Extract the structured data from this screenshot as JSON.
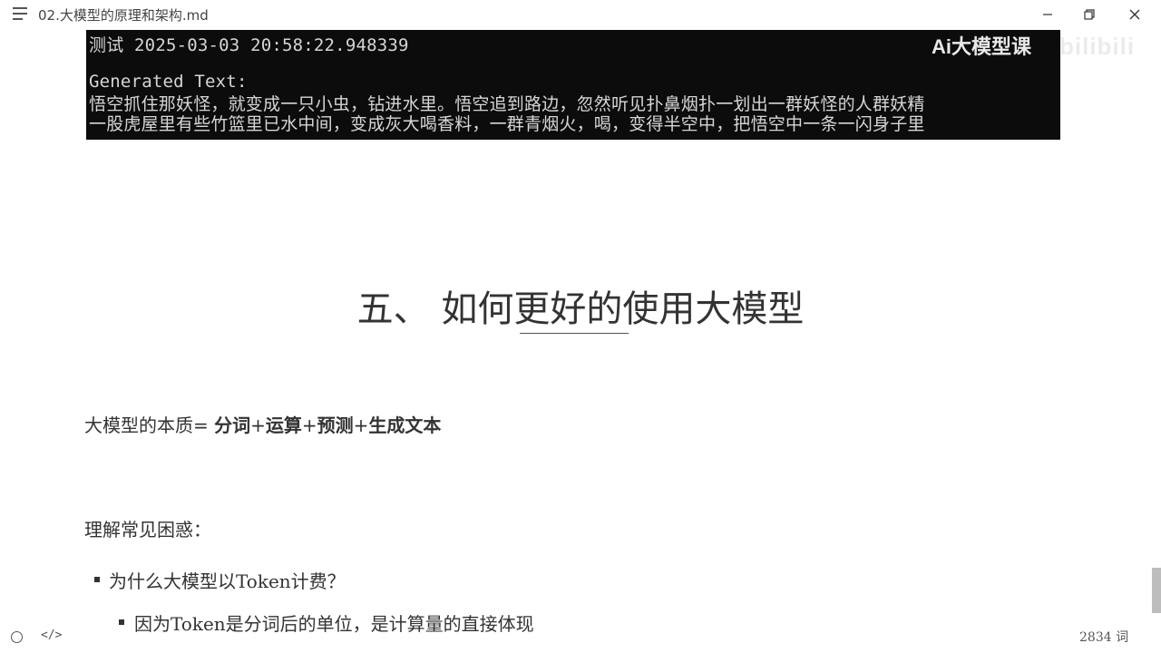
{
  "window": {
    "title": "02.大模型的原理和架构.md",
    "menu_icon": "hamburger-icon",
    "minimize_icon": "minimize-icon",
    "maximize_icon": "restore-icon",
    "close_icon": "close-icon"
  },
  "terminal": {
    "lines": [
      "测试 2025-03-03 20:58:22.948339",
      "Generated Text:",
      "悟空抓住那妖怪，就变成一只小虫，钻进水里。悟空追到路边，忽然听见扑鼻烟扑一划出一群妖怪的人群妖精",
      "一股虎屋里有些竹篮里已水中间，变成灰大喝香料，一群青烟火，喝，变得半空中，把悟空中一条一闪身子里"
    ],
    "watermark": "Ai大模型课",
    "logo": "bilibili"
  },
  "content": {
    "heading": "五、 如何更好的使用大模型",
    "essence_prefix": "大模型的本质= ",
    "essence_parts": [
      "分词",
      "+",
      "运算",
      "+",
      "预测",
      "+",
      "生成文本"
    ],
    "confusion_label": "理解常见困惑：",
    "bullet1": "为什么大模型以Token计费？",
    "bullet2": "因为Token是分词后的单位，是计算量的直接体现"
  },
  "status": {
    "word_count": "2834 词",
    "source_icon": "code-icon",
    "outline_icon": "circle-icon"
  }
}
